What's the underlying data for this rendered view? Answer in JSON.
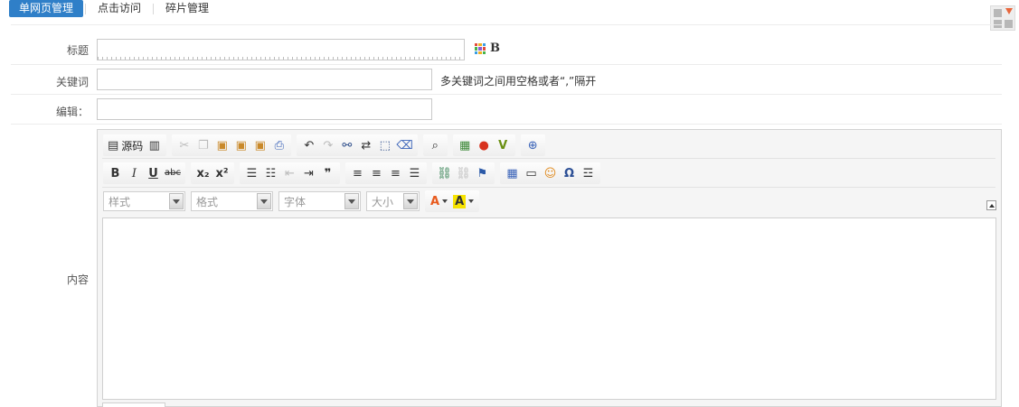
{
  "tabs": [
    {
      "label": "单网页管理",
      "active": true
    },
    {
      "label": "点击访问",
      "active": false
    },
    {
      "label": "碎片管理",
      "active": false
    }
  ],
  "form": {
    "title_label": "标题",
    "title_value": "",
    "keywords_label": "关键词",
    "keywords_value": "",
    "keywords_hint": "多关键词之间用空格或者“,”隔开",
    "editor_label": "编辑：",
    "editor_value": "",
    "content_label": "内容",
    "bold_glyph": "B"
  },
  "toolbar": {
    "source_label": "源码",
    "combos": {
      "style": "样式",
      "format": "格式",
      "font": "字体",
      "size": "大小"
    },
    "text_color_glyph": "A",
    "bg_color_glyph": "A",
    "text_color": "#e85a1d",
    "bg_color": "#f7e300"
  },
  "colors": {
    "active_tab": "#2f7fc8",
    "accent_orange": "#e8663c"
  }
}
